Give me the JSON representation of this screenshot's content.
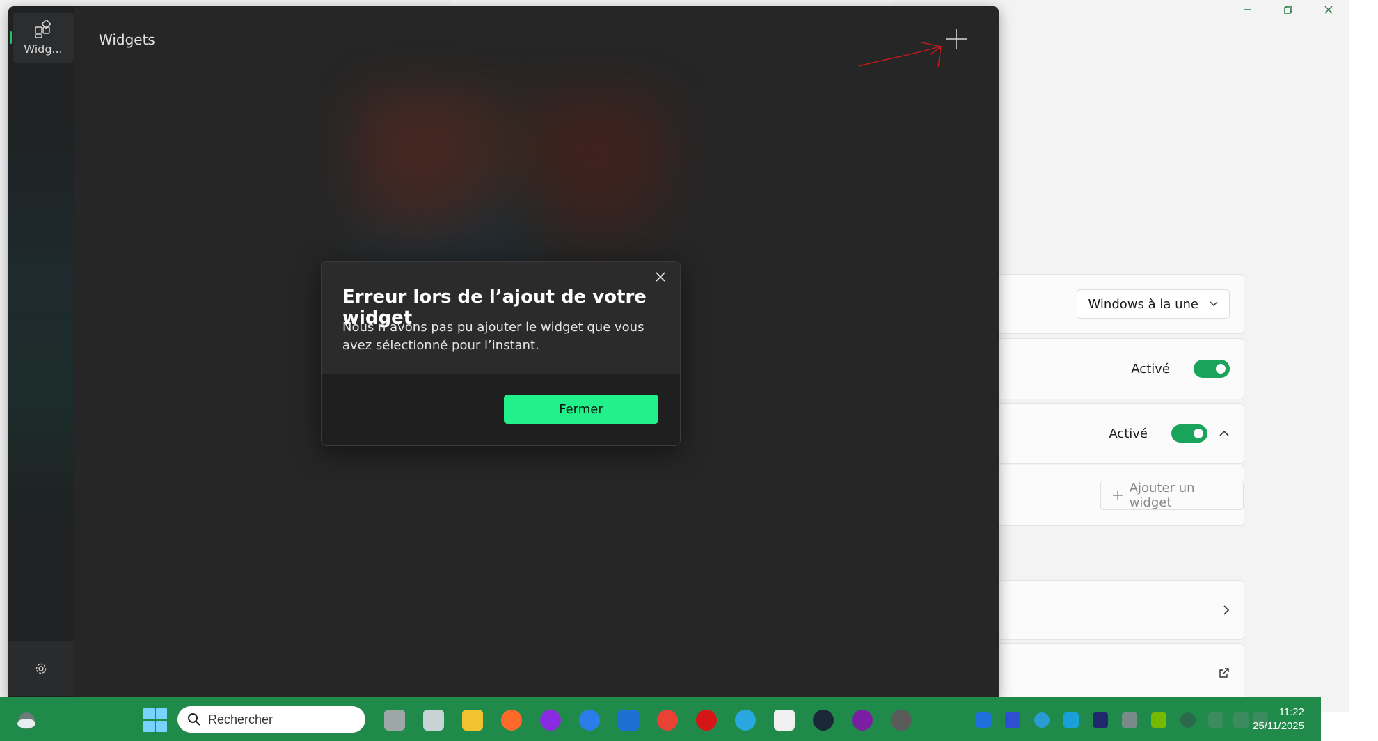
{
  "widgets_window": {
    "title": "Widgets",
    "sidebar": {
      "active_item_label": "Widg..."
    }
  },
  "dialog": {
    "title": "Erreur lors de l’ajout de votre widget",
    "body": "Nous n’avons pas pu ajouter le widget que vous avez sélectionné pour l’instant.",
    "button_label": "Fermer"
  },
  "settings": {
    "dropdown_value": "Windows à la une",
    "toggle1_label": "Activé",
    "toggle2_label": "Activé",
    "add_widget_label": "Ajouter un widget"
  },
  "taskbar": {
    "search_placeholder": "Rechercher",
    "time": "11:22",
    "date": "25/11/2025"
  },
  "colors": {
    "accent_green": "#22f08a",
    "taskbar_green": "#1f8a4a",
    "toggle_green": "#1aa35a"
  }
}
